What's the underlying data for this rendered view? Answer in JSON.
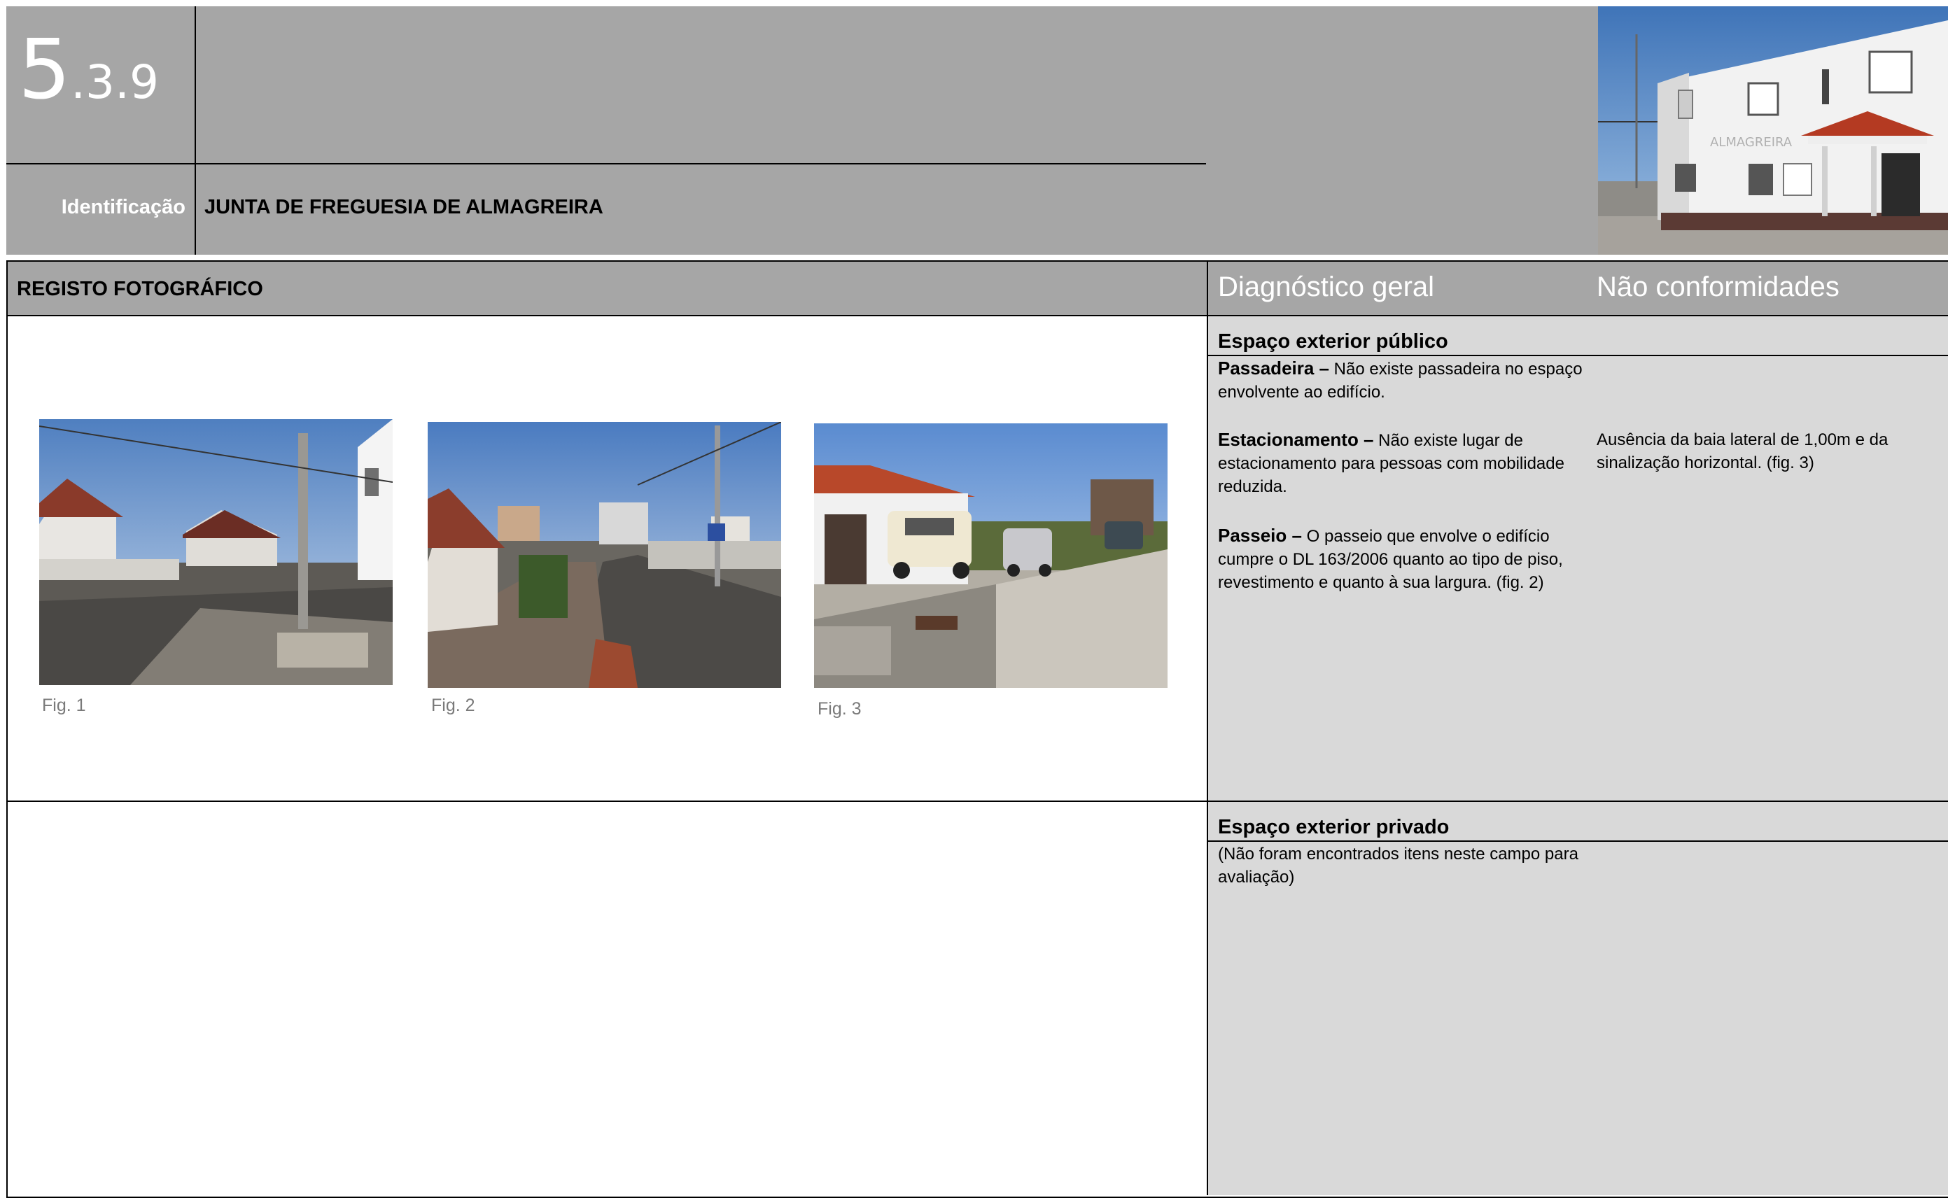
{
  "header": {
    "section_number_main": "5",
    "section_number_sub": ".3.9",
    "identification_label": "Identificação",
    "identification_value": "JUNTA DE FREGUESIA DE ALMAGREIRA"
  },
  "table": {
    "left_header": "REGISTO FOTOGRÁFICO",
    "diagnosis_header": "Diagnóstico geral",
    "nonconformities_header": "Não conformidades"
  },
  "figures": [
    {
      "caption": "Fig. 1"
    },
    {
      "caption": "Fig. 2"
    },
    {
      "caption": "Fig. 3"
    }
  ],
  "public_space": {
    "title": "Espaço exterior público",
    "items": [
      {
        "term": "Passadeira –",
        "text": " Não existe passadeira no espaço envolvente ao edifício."
      },
      {
        "term": "Estacionamento –",
        "text": " Não existe lugar de estacionamento para pessoas com mobilidade reduzida."
      },
      {
        "term": "Passeio –",
        "text": " O passeio que envolve o edifício cumpre o DL 163/2006 quanto ao tipo de piso, revestimento e quanto à sua largura. (fig. 2)"
      }
    ],
    "nonconformity": "Ausência da baia lateral de 1,00m e da sinalização horizontal. (fig. 3)"
  },
  "private_space": {
    "title": "Espaço exterior privado",
    "text": "(Não foram encontrados itens neste campo para avaliação)"
  }
}
